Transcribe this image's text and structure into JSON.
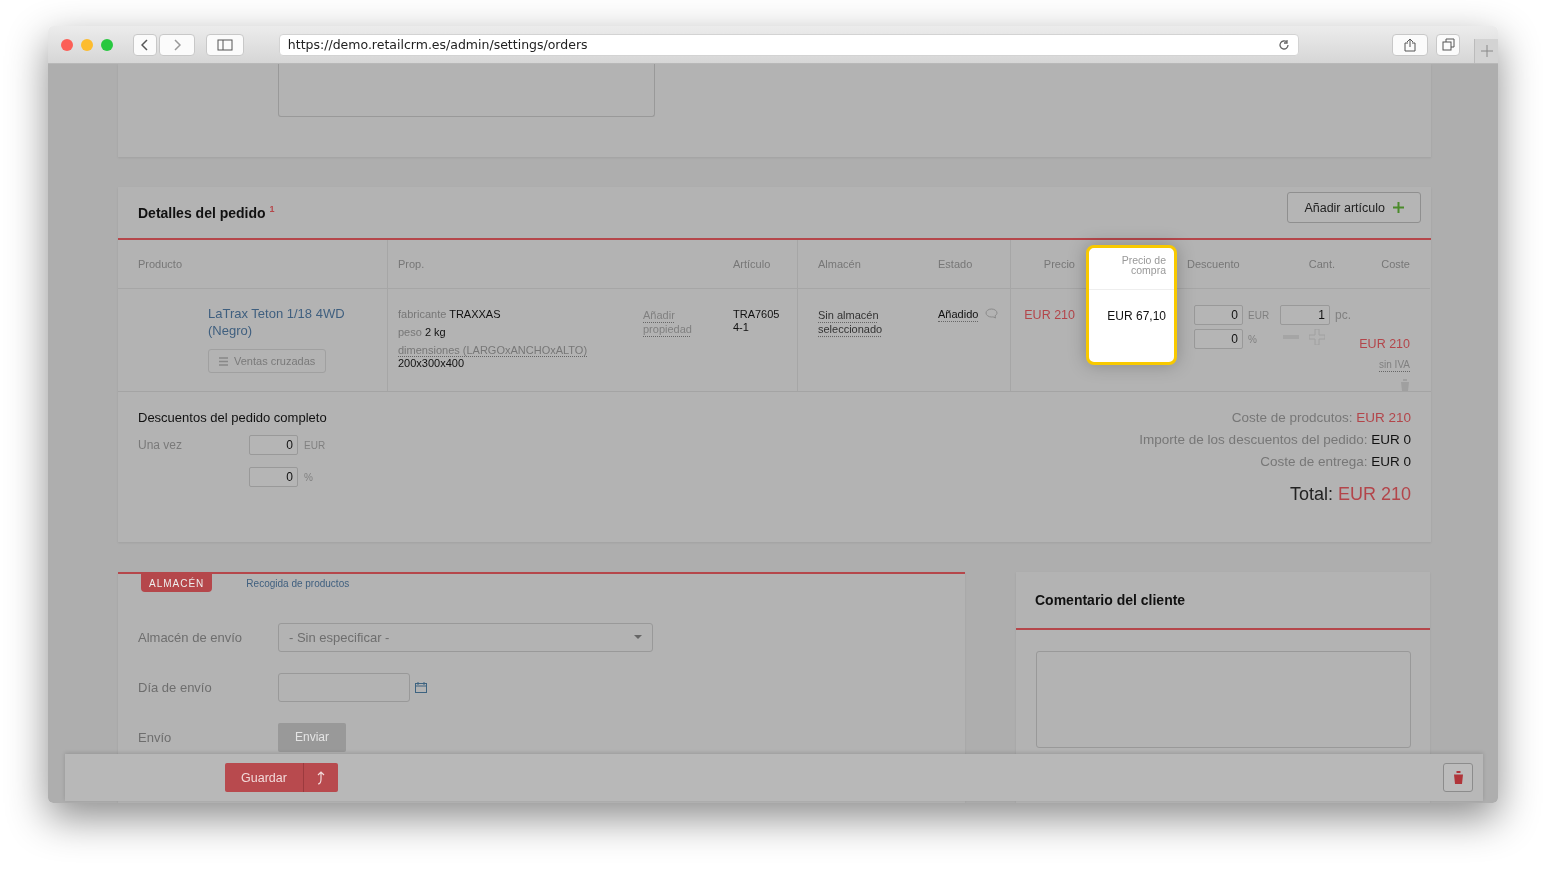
{
  "browser": {
    "url": "https://demo.retailcrm.es/admin/settings/orders"
  },
  "order_details": {
    "title": "Detalles del pedido",
    "title_note": "1",
    "add_button": "Añadir artículo",
    "columns": [
      {
        "label": "Producto",
        "highlighted": false
      },
      {
        "label": "Prop.",
        "highlighted": false
      },
      {
        "label": "Artículo",
        "highlighted": false
      },
      {
        "label": "Almacén",
        "highlighted": false
      },
      {
        "label": "Estado",
        "highlighted": false
      },
      {
        "label": "Precio",
        "highlighted": false
      },
      {
        "label": "Precio de compra",
        "highlighted": true
      },
      {
        "label": "Descuento",
        "highlighted": false
      },
      {
        "label": "Cant.",
        "highlighted": false
      },
      {
        "label": "Coste",
        "highlighted": false
      }
    ],
    "rows": [
      {
        "product": "LaTrax Teton 1/18 4WD (Negro)",
        "cross_sell_button": "Ventas cruzadas",
        "properties": [
          {
            "name": "fabricante",
            "value": "TRAXXAS",
            "kind": "inline"
          },
          {
            "name": "peso",
            "value": "2 kg",
            "kind": "inline"
          },
          {
            "name": "dimensiones (LARGOxANCHOxALTO)",
            "value": "200x300x400",
            "kind": "block"
          }
        ],
        "add_property": "Añadir propiedad",
        "sku": "TRA7605 4-1",
        "warehouse": "Sin almacén seleccionado",
        "status": "Añadido",
        "price": "EUR 210",
        "purchase_price": "EUR 67,10",
        "discount_amount": "0",
        "discount_currency": "EUR",
        "discount_percent": "0",
        "percent_sign": "%",
        "quantity": "1",
        "unit": "pc.",
        "cost": "EUR 210",
        "tax_note": "sin IVA"
      }
    ],
    "order_discounts": {
      "title": "Descuentos del pedido completo",
      "label": "Una vez",
      "amount": "0",
      "currency": "EUR",
      "percent": "0",
      "percent_sign": "%"
    },
    "totals": [
      {
        "label": "Coste de prodcutos:",
        "value": "EUR 210",
        "kind": "accent"
      },
      {
        "label": "Importe de los descuentos del pedido:",
        "value": "EUR 0",
        "kind": "plain"
      },
      {
        "label": "Coste de entrega:",
        "value": "EUR 0",
        "kind": "plain"
      }
    ],
    "total": {
      "label": "Total:",
      "value": "EUR 210"
    }
  },
  "shipping": {
    "tabs": [
      {
        "label": "ALMACÉN",
        "selected": true
      },
      {
        "label": "Recogida de productos",
        "selected": false
      }
    ],
    "warehouse_label": "Almacén de envío",
    "warehouse_value": "- Sin especificar -",
    "date_label": "Día de envío",
    "send_label": "Envío",
    "send_button": "Enviar"
  },
  "comment": {
    "title": "Comentario del cliente"
  },
  "footer": {
    "save_button": "Guardar"
  }
}
